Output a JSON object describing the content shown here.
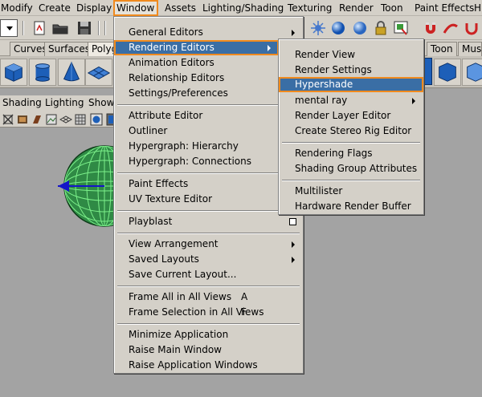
{
  "menubar": {
    "items": [
      {
        "label": "Modify"
      },
      {
        "label": "Create"
      },
      {
        "label": "Display"
      },
      {
        "label": "Window"
      },
      {
        "label": "Assets"
      },
      {
        "label": "Lighting/Shading"
      },
      {
        "label": "Texturing"
      },
      {
        "label": "Render"
      },
      {
        "label": "Toon"
      },
      {
        "label": "Paint Effects"
      },
      {
        "label": "H"
      }
    ]
  },
  "shelf": {
    "tabs": [
      {
        "label": "Curves"
      },
      {
        "label": "Surfaces"
      },
      {
        "label": "Polyg"
      },
      {
        "label": "Toon"
      },
      {
        "label": "Musc"
      }
    ]
  },
  "panel": {
    "menus": [
      {
        "label": "Shading"
      },
      {
        "label": "Lighting"
      },
      {
        "label": "Show"
      }
    ]
  },
  "window_menu": {
    "items": [
      {
        "label": "General Editors"
      },
      {
        "label": "Rendering Editors"
      },
      {
        "label": "Animation Editors"
      },
      {
        "label": "Relationship Editors"
      },
      {
        "label": "Settings/Preferences"
      },
      {
        "label": "Attribute Editor"
      },
      {
        "label": "Outliner"
      },
      {
        "label": "Hypergraph: Hierarchy"
      },
      {
        "label": "Hypergraph: Connections"
      },
      {
        "label": "Paint Effects"
      },
      {
        "label": "UV Texture Editor"
      },
      {
        "label": "Playblast"
      },
      {
        "label": "View Arrangement"
      },
      {
        "label": "Saved Layouts"
      },
      {
        "label": "Save Current Layout..."
      },
      {
        "label": "Frame All in All Views",
        "shortcut": "A"
      },
      {
        "label": "Frame Selection in All Views",
        "shortcut": "F"
      },
      {
        "label": "Minimize Application"
      },
      {
        "label": "Raise Main Window"
      },
      {
        "label": "Raise Application Windows"
      }
    ]
  },
  "rendering_submenu": {
    "items": [
      {
        "label": "Render View"
      },
      {
        "label": "Render Settings"
      },
      {
        "label": "Hypershade"
      },
      {
        "label": "mental ray"
      },
      {
        "label": "Render Layer Editor"
      },
      {
        "label": "Create Stereo Rig Editor"
      },
      {
        "label": "Rendering Flags"
      },
      {
        "label": "Shading Group Attributes"
      },
      {
        "label": "Multilister"
      },
      {
        "label": "Hardware Render Buffer"
      }
    ]
  },
  "colors": {
    "highlight": "#3a6ea5",
    "callout": "#f08a1e",
    "menu_bg": "#d4d0c8",
    "viewport_bg": "#a3a3a3"
  }
}
